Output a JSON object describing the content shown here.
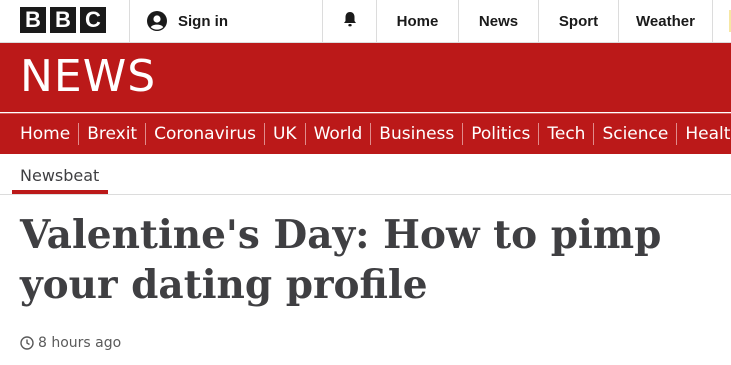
{
  "topbar": {
    "logo_letters": [
      "B",
      "B",
      "C"
    ],
    "signin_label": "Sign in",
    "nav_items": [
      {
        "label": "Home"
      },
      {
        "label": "News"
      },
      {
        "label": "Sport"
      },
      {
        "label": "Weather"
      }
    ],
    "icons": {
      "user": "user-icon",
      "notifications": "bell-icon"
    }
  },
  "banner": {
    "title": "NEWS",
    "color": "#bb1919"
  },
  "section_nav": {
    "items": [
      "Home",
      "Brexit",
      "Coronavirus",
      "UK",
      "World",
      "Business",
      "Politics",
      "Tech",
      "Science",
      "Health"
    ]
  },
  "sub_nav": {
    "active_item": "Newsbeat",
    "accent": "#bb1919"
  },
  "article": {
    "headline": "Valentine's Day: How to pimp your dating profile",
    "timestamp": "8 hours ago",
    "timestamp_icon": "clock-icon"
  }
}
